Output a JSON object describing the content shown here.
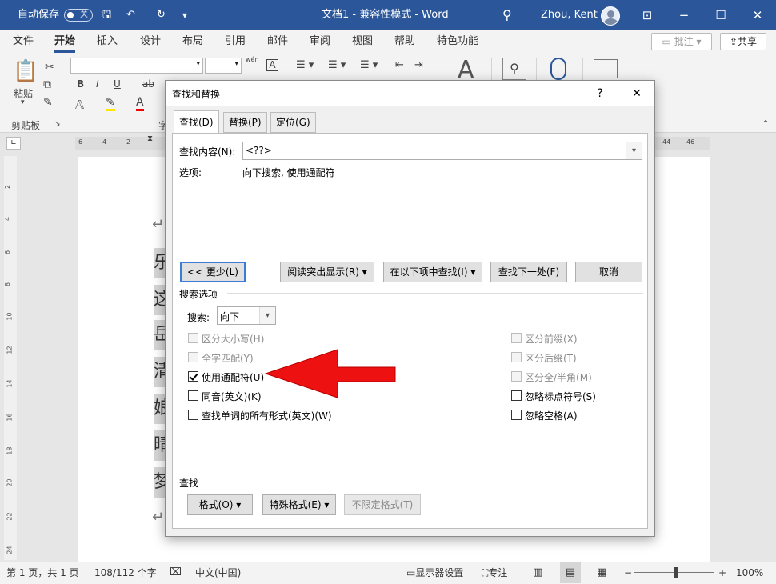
{
  "titlebar": {
    "autosave_label": "自动保存",
    "autosave_state": "关",
    "doc_title": "文档1 - 兼容性模式 - Word",
    "user_name": "Zhou, Kent"
  },
  "menu": {
    "items": [
      "文件",
      "开始",
      "插入",
      "设计",
      "布局",
      "引用",
      "邮件",
      "审阅",
      "视图",
      "帮助",
      "特色功能"
    ],
    "active": "开始",
    "comment_label": "批注",
    "share_label": "共享"
  },
  "ribbon": {
    "paste_label": "粘贴",
    "clipboard_label": "剪贴板",
    "font_group_stub": "字",
    "wen_glyph": "wén",
    "a_box_glyph": "A",
    "bold": "B",
    "italic": "I",
    "underline": "U",
    "strike": "ab",
    "font_color_glyph": "A"
  },
  "ruler": {
    "ticks_left": [
      "6",
      "4",
      "2"
    ],
    "ticks_right": [
      "44",
      "46"
    ],
    "vticks": [
      "2",
      "4",
      "6",
      "8",
      "10",
      "12",
      "14",
      "16",
      "18",
      "20",
      "22",
      "24"
    ]
  },
  "document": {
    "chars": [
      "乐",
      "这",
      "岳",
      "清",
      "娘",
      "晴",
      "梦"
    ]
  },
  "status": {
    "page": "第 1 页，共 1 页",
    "words": "108/112 个字",
    "language": "中文(中国)",
    "display_settings": "显示器设置",
    "focus": "专注",
    "zoom_minus": "−",
    "zoom_plus": "+",
    "zoom": "100%"
  },
  "dialog": {
    "title": "查找和替换",
    "help": "?",
    "close": "✕",
    "tabs": [
      "查找(D)",
      "替换(P)",
      "定位(G)"
    ],
    "active_tab": "查找(D)",
    "find_label": "查找内容(N):",
    "find_value": "<??>",
    "options_label": "选项:",
    "options_value": "向下搜索, 使用通配符",
    "btn_less": "<< 更少(L)",
    "btn_highlight": "阅读突出显示(R) ▾",
    "btn_find_in": "在以下项中查找(I) ▾",
    "btn_find_next": "查找下一处(F)",
    "btn_cancel": "取消",
    "search_options_title": "搜索选项",
    "search_label": "搜索:",
    "search_value": "向下",
    "options": {
      "match_case": "区分大小写(H)",
      "whole_word": "全字匹配(Y)",
      "wildcards": "使用通配符(U)",
      "sounds_like": "同音(英文)(K)",
      "all_forms": "查找单词的所有形式(英文)(W)",
      "match_prefix": "区分前缀(X)",
      "match_suffix": "区分后缀(T)",
      "match_width": "区分全/半角(M)",
      "ignore_punct": "忽略标点符号(S)",
      "ignore_space": "忽略空格(A)"
    },
    "find_section_title": "查找",
    "btn_format": "格式(O) ▾",
    "btn_special": "特殊格式(E) ▾",
    "btn_no_format": "不限定格式(T)"
  },
  "colors": {
    "word_blue": "#2b579a",
    "annotation_arrow": "#ee1111"
  }
}
